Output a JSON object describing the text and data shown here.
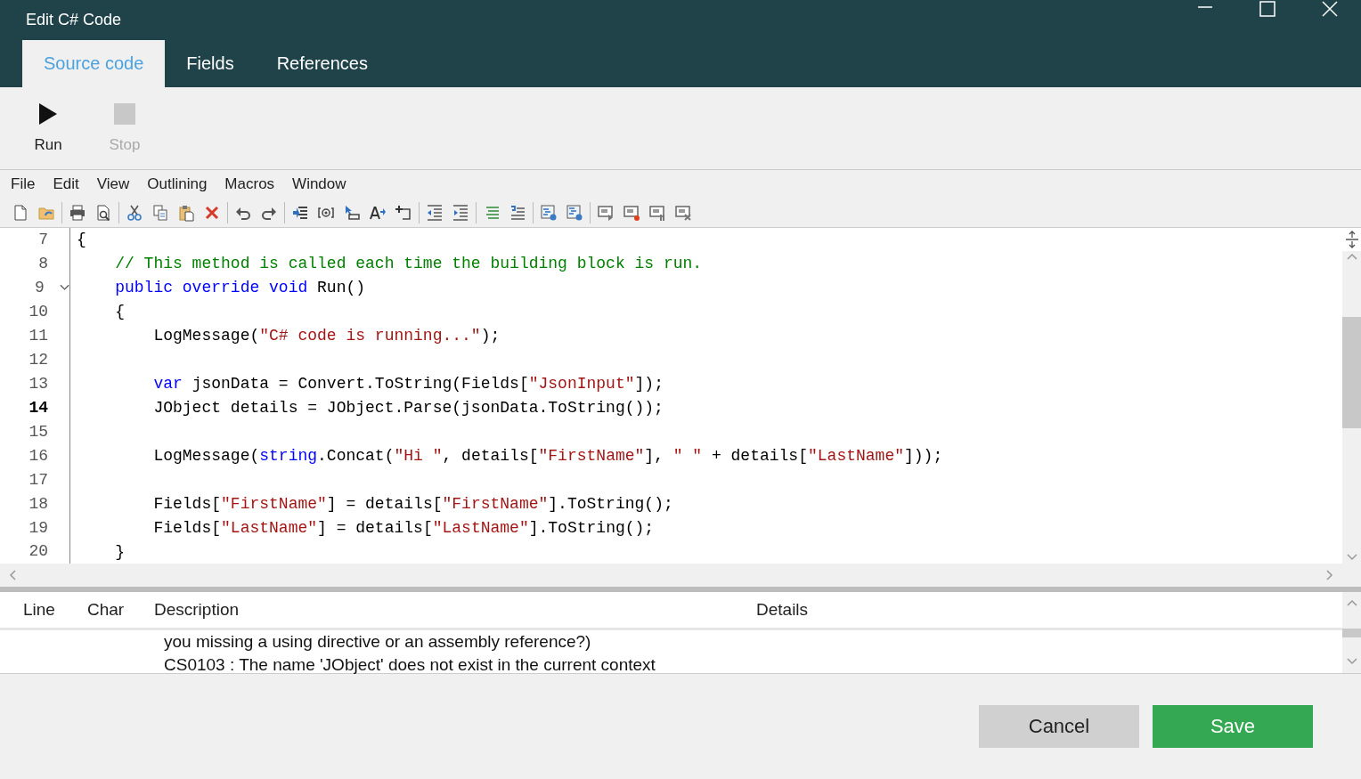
{
  "window": {
    "title": "Edit C# Code"
  },
  "tabs": [
    {
      "label": "Source code",
      "selected": true
    },
    {
      "label": "Fields",
      "selected": false
    },
    {
      "label": "References",
      "selected": false
    }
  ],
  "ribbon": [
    {
      "label": "Run",
      "kind": "run",
      "disabled": false
    },
    {
      "label": "Stop",
      "kind": "stop",
      "disabled": true
    }
  ],
  "menu": [
    "File",
    "Edit",
    "View",
    "Outlining",
    "Macros",
    "Window"
  ],
  "editor": {
    "lines": [
      {
        "number": "7",
        "current": false,
        "tokens": [
          {
            "kind": "plain",
            "text": "{"
          }
        ]
      },
      {
        "number": "8",
        "current": false,
        "tokens": [
          {
            "kind": "comment",
            "text": "    // This method is called each time the building block is run."
          }
        ]
      },
      {
        "number": "9",
        "current": false,
        "expanded": true,
        "tokens": [
          {
            "kind": "keyword",
            "text": "    public override void"
          },
          {
            "kind": "plain",
            "text": " Run()"
          }
        ]
      },
      {
        "number": "10",
        "current": false,
        "tokens": [
          {
            "kind": "plain",
            "text": "    {"
          }
        ]
      },
      {
        "number": "11",
        "current": false,
        "tokens": [
          {
            "kind": "plain",
            "text": "        LogMessage("
          },
          {
            "kind": "string",
            "text": "\"C# code is running...\""
          },
          {
            "kind": "plain",
            "text": ");"
          }
        ]
      },
      {
        "number": "12",
        "current": false
      },
      {
        "number": "13",
        "current": false,
        "tokens": [
          {
            "kind": "keyword",
            "text": "        var"
          },
          {
            "kind": "plain",
            "text": " jsonData = Convert.ToString(Fields["
          },
          {
            "kind": "string",
            "text": "\"JsonInput\""
          },
          {
            "kind": "plain",
            "text": "]);"
          }
        ]
      },
      {
        "number": "14",
        "current": true,
        "tokens": [
          {
            "kind": "plain",
            "text": "        JObject details = JObject.Parse(jsonData.ToString());"
          }
        ]
      },
      {
        "number": "15",
        "current": false
      },
      {
        "number": "16",
        "current": false,
        "tokens": [
          {
            "kind": "plain",
            "text": "        LogMessage("
          },
          {
            "kind": "keyword",
            "text": "string"
          },
          {
            "kind": "plain",
            "text": ".Concat("
          },
          {
            "kind": "string",
            "text": "\"Hi \""
          },
          {
            "kind": "plain",
            "text": ", details["
          },
          {
            "kind": "string",
            "text": "\"FirstName\""
          },
          {
            "kind": "plain",
            "text": "], "
          },
          {
            "kind": "string",
            "text": "\" \""
          },
          {
            "kind": "plain",
            "text": " + details["
          },
          {
            "kind": "string",
            "text": "\"LastName\""
          },
          {
            "kind": "plain",
            "text": "]));"
          }
        ]
      },
      {
        "number": "17",
        "current": false
      },
      {
        "number": "18",
        "current": false,
        "tokens": [
          {
            "kind": "plain",
            "text": "        Fields["
          },
          {
            "kind": "string",
            "text": "\"FirstName\""
          },
          {
            "kind": "plain",
            "text": "] = details["
          },
          {
            "kind": "string",
            "text": "\"FirstName\""
          },
          {
            "kind": "plain",
            "text": "].ToString();"
          }
        ]
      },
      {
        "number": "19",
        "current": false,
        "tokens": [
          {
            "kind": "plain",
            "text": "        Fields["
          },
          {
            "kind": "string",
            "text": "\"LastName\""
          },
          {
            "kind": "plain",
            "text": "] = details["
          },
          {
            "kind": "string",
            "text": "\"LastName\""
          },
          {
            "kind": "plain",
            "text": "].ToString();"
          }
        ]
      },
      {
        "number": "20",
        "current": false,
        "tokens": [
          {
            "kind": "plain",
            "text": "    }"
          }
        ]
      }
    ]
  },
  "error_list": {
    "columns": [
      "Line",
      "Char",
      "Description",
      "Details"
    ],
    "rows": [
      {
        "description": "you missing a using directive or an assembly reference?)"
      },
      {
        "description": "CS0103 : The name 'JObject' does not exist in the current context"
      }
    ]
  },
  "buttons": [
    {
      "label": "Cancel",
      "kind": "secondary"
    },
    {
      "label": "Save",
      "kind": "primary"
    }
  ]
}
